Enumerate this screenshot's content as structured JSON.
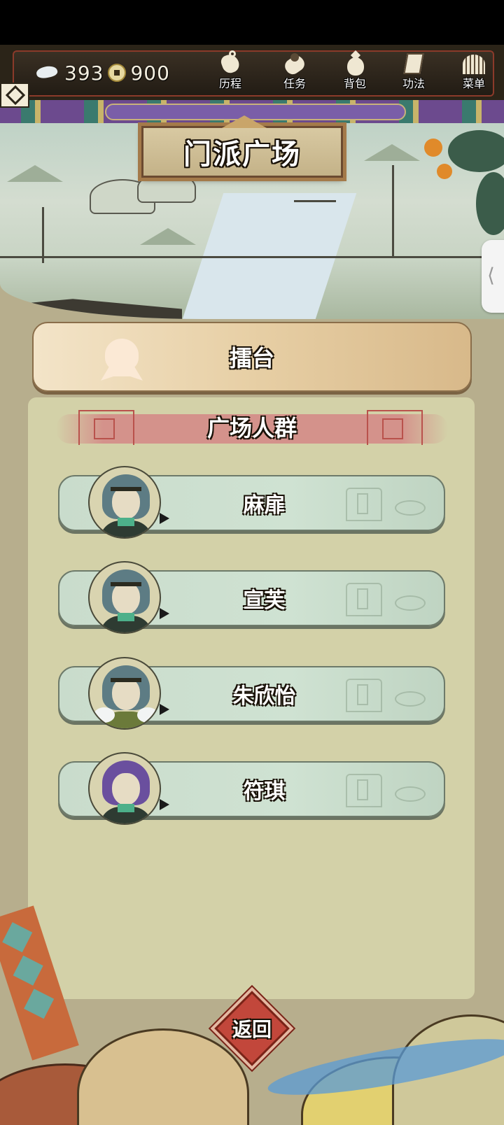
{
  "resources": {
    "spirit_stones": "393",
    "coins": "900"
  },
  "top_menu": [
    {
      "key": "history",
      "label": "历程",
      "icon": "history-icon"
    },
    {
      "key": "tasks",
      "label": "任务",
      "icon": "scroll-icon"
    },
    {
      "key": "bag",
      "label": "背包",
      "icon": "bag-icon"
    },
    {
      "key": "skills",
      "label": "功法",
      "icon": "book-icon"
    },
    {
      "key": "menu",
      "label": "菜单",
      "icon": "fan-icon"
    }
  ],
  "page": {
    "title": "门派广场"
  },
  "arena": {
    "label": "擂台"
  },
  "crowd": {
    "title": "广场人群",
    "npcs": [
      {
        "name": "麻扉",
        "hair": "teal"
      },
      {
        "name": "宣芙",
        "hair": "teal"
      },
      {
        "name": "朱欣怡",
        "hair": "teal"
      },
      {
        "name": "符琪",
        "hair": "purple"
      }
    ]
  },
  "back": {
    "label": "返回"
  },
  "colors": {
    "panel_bg": "#d3d1a8",
    "npc_row_bg": "#c9dccc",
    "arena_bg": "#e7cfa5",
    "back_button": "#c2473b",
    "header_ribbon": "#d4928b"
  }
}
